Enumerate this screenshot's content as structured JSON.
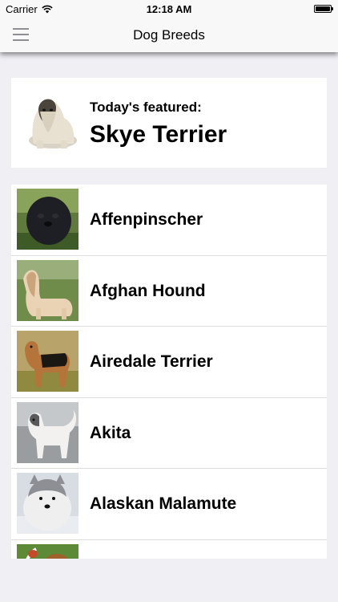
{
  "status_bar": {
    "carrier": "Carrier",
    "time": "12:18 AM",
    "wifi_icon": "wifi-icon",
    "battery_icon": "battery-full-icon"
  },
  "nav": {
    "title": "Dog Breeds",
    "menu_icon": "hamburger-menu-icon"
  },
  "featured": {
    "label": "Today's featured:",
    "name": "Skye Terrier",
    "image": "skye-terrier-photo"
  },
  "breeds": [
    {
      "name": "Affenpinscher",
      "image": "affenpinscher-photo"
    },
    {
      "name": "Afghan Hound",
      "image": "afghan-hound-photo"
    },
    {
      "name": "Airedale Terrier",
      "image": "airedale-terrier-photo"
    },
    {
      "name": "Akita",
      "image": "akita-photo"
    },
    {
      "name": "Alaskan Malamute",
      "image": "alaskan-malamute-photo"
    },
    {
      "name": "",
      "image": "next-breed-photo-partial"
    }
  ]
}
